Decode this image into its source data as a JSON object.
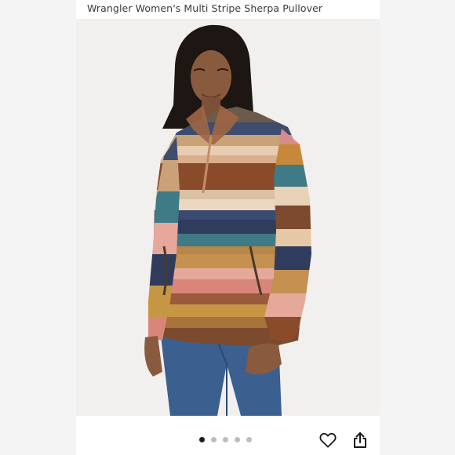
{
  "listing": {
    "title": "Wrangler Women's Multi Stripe Sherpa Pullover"
  },
  "carousel": {
    "total_images": 5,
    "active_index": 0
  },
  "actions": {
    "like_icon": "heart-outline-icon",
    "share_icon": "share-upload-icon"
  },
  "colors": {
    "page_background": "#f4f4f4",
    "card_background": "#ffffff",
    "title_text": "#3b3b3b",
    "dot_active": "#1e1e1e",
    "dot_inactive": "#bdbdbd"
  }
}
